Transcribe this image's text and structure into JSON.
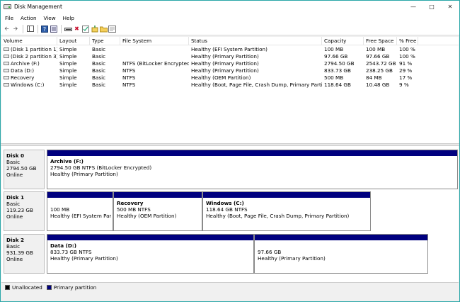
{
  "window": {
    "title": "Disk Management"
  },
  "menu": [
    "File",
    "Action",
    "View",
    "Help"
  ],
  "toolbar": {
    "icons": [
      "back-arrow-icon",
      "forward-arrow-icon",
      "console-tree-icon",
      "help-icon",
      "properties-icon",
      "connect-icon",
      "delete-icon",
      "check-icon",
      "format-icon",
      "folder-icon",
      "refresh-icon"
    ]
  },
  "columns": [
    "Volume",
    "Layout",
    "Type",
    "File System",
    "Status",
    "Capacity",
    "Free Space",
    "% Free"
  ],
  "volumes": [
    {
      "volume": "(Disk 1 partition 1)",
      "layout": "Simple",
      "type": "Basic",
      "fs": "",
      "status": "Healthy (EFI System Partition)",
      "capacity": "100 MB",
      "free": "100 MB",
      "pct": "100 %"
    },
    {
      "volume": "(Disk 2 partition 3)",
      "layout": "Simple",
      "type": "Basic",
      "fs": "",
      "status": "Healthy (Primary Partition)",
      "capacity": "97.66 GB",
      "free": "97.66 GB",
      "pct": "100 %"
    },
    {
      "volume": "Archive (F:)",
      "layout": "Simple",
      "type": "Basic",
      "fs": "NTFS (BitLocker Encrypted)",
      "status": "Healthy (Primary Partition)",
      "capacity": "2794.50 GB",
      "free": "2543.72 GB",
      "pct": "91 %"
    },
    {
      "volume": "Data (D:)",
      "layout": "Simple",
      "type": "Basic",
      "fs": "NTFS",
      "status": "Healthy (Primary Partition)",
      "capacity": "833.73 GB",
      "free": "238.25 GB",
      "pct": "29 %"
    },
    {
      "volume": "Recovery",
      "layout": "Simple",
      "type": "Basic",
      "fs": "NTFS",
      "status": "Healthy (OEM Partition)",
      "capacity": "500 MB",
      "free": "84 MB",
      "pct": "17 %"
    },
    {
      "volume": "Windows (C:)",
      "layout": "Simple",
      "type": "Basic",
      "fs": "NTFS",
      "status": "Healthy (Boot, Page File, Crash Dump, Primary Partition)",
      "capacity": "118.64 GB",
      "free": "10.48 GB",
      "pct": "9 %"
    }
  ],
  "disks": [
    {
      "name": "Disk 0",
      "type": "Basic",
      "size": "2794.50 GB",
      "state": "Online",
      "partitions": [
        {
          "name": "Archive  (F:)",
          "size": "2794.50 GB NTFS (BitLocker Encrypted)",
          "status": "Healthy (Primary Partition)"
        }
      ]
    },
    {
      "name": "Disk 1",
      "type": "Basic",
      "size": "119.23 GB",
      "state": "Online",
      "partitions": [
        {
          "name": "",
          "size": "100 MB",
          "status": "Healthy (EFI System Partiti"
        },
        {
          "name": "Recovery",
          "size": "500 MB NTFS",
          "status": "Healthy (OEM Partition)"
        },
        {
          "name": "Windows  (C:)",
          "size": "118.64 GB NTFS",
          "status": "Healthy (Boot, Page File, Crash Dump, Primary Partition)"
        }
      ]
    },
    {
      "name": "Disk 2",
      "type": "Basic",
      "size": "931.39 GB",
      "state": "Online",
      "partitions": [
        {
          "name": "Data  (D:)",
          "size": "833.73 GB NTFS",
          "status": "Healthy (Primary Partition)"
        },
        {
          "name": "",
          "size": "97.66 GB",
          "status": "Healthy (Primary Partition)"
        }
      ]
    }
  ],
  "legend": [
    {
      "label": "Unallocated",
      "color": "#000000"
    },
    {
      "label": "Primary partition",
      "color": "#00007f"
    }
  ]
}
